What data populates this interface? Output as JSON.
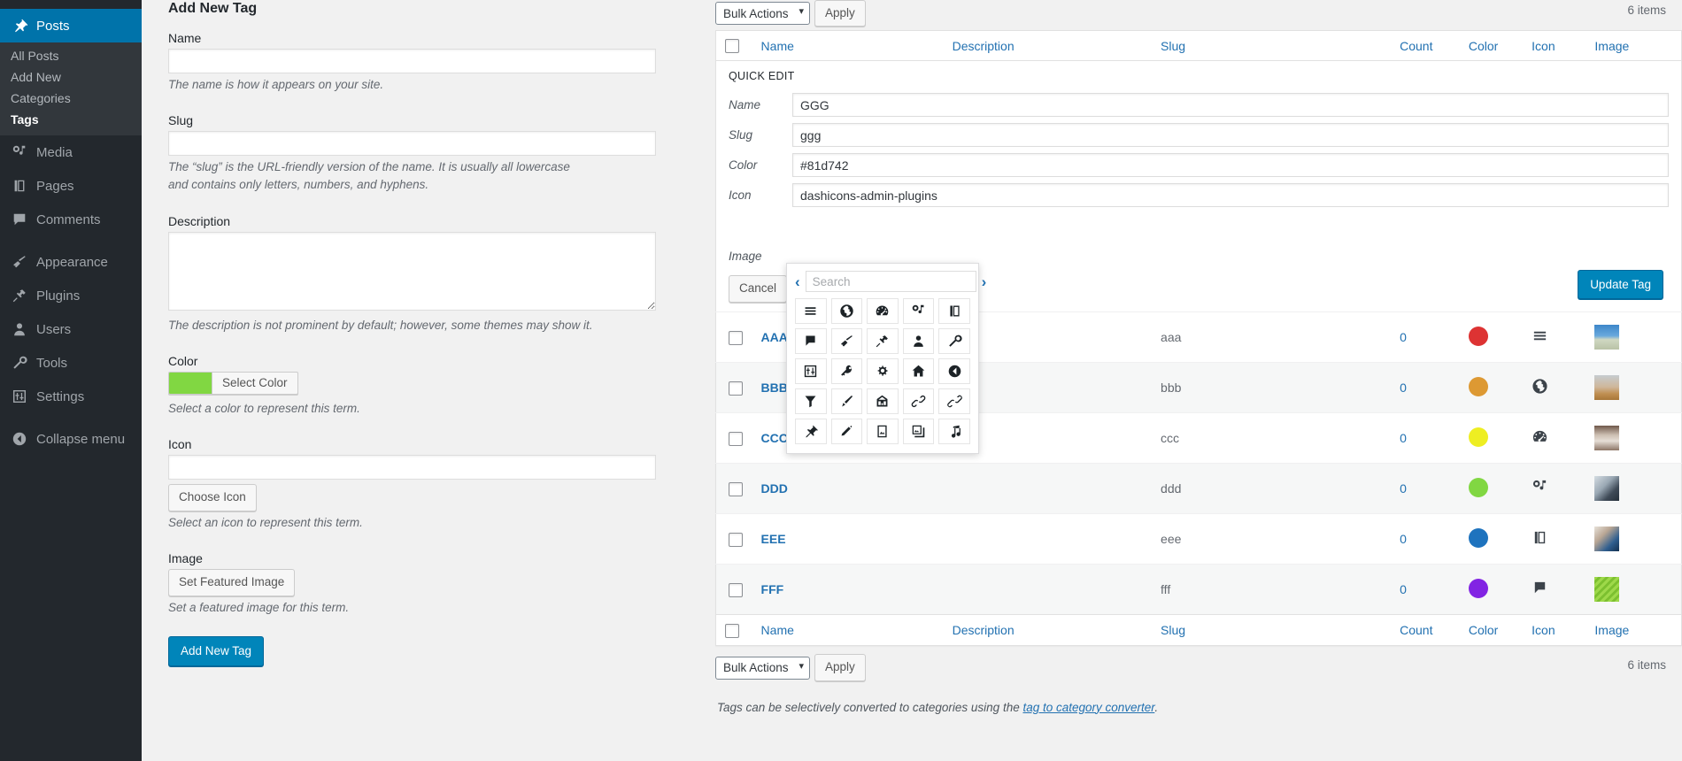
{
  "sidebar": {
    "items": [
      {
        "label": "Posts",
        "icon": "pin-icon",
        "name": "posts",
        "current": true,
        "submenu": [
          {
            "label": "All Posts",
            "name": "all-posts",
            "current": false
          },
          {
            "label": "Add New",
            "name": "add-new",
            "current": false
          },
          {
            "label": "Categories",
            "name": "categories",
            "current": false
          },
          {
            "label": "Tags",
            "name": "tags",
            "current": true
          }
        ]
      },
      {
        "label": "Media",
        "icon": "media-icon",
        "name": "media",
        "current": false
      },
      {
        "label": "Pages",
        "icon": "pages-icon",
        "name": "pages",
        "current": false
      },
      {
        "label": "Comments",
        "icon": "comments-icon",
        "name": "comments",
        "current": false
      },
      {
        "label": "Appearance",
        "icon": "appearance-icon",
        "name": "appearance",
        "current": false
      },
      {
        "label": "Plugins",
        "icon": "plugins-icon",
        "name": "plugins",
        "current": false
      },
      {
        "label": "Users",
        "icon": "users-icon",
        "name": "users",
        "current": false
      },
      {
        "label": "Tools",
        "icon": "tools-icon",
        "name": "tools",
        "current": false
      },
      {
        "label": "Settings",
        "icon": "settings-icon",
        "name": "settings",
        "current": false
      },
      {
        "label": "Collapse menu",
        "icon": "collapse-icon",
        "name": "collapse-menu",
        "current": false
      }
    ]
  },
  "add_form": {
    "heading": "Add New Tag",
    "name_label": "Name",
    "name_value": "",
    "name_hint": "The name is how it appears on your site.",
    "slug_label": "Slug",
    "slug_value": "",
    "slug_hint": "The “slug” is the URL-friendly version of the name. It is usually all lowercase and contains only letters, numbers, and hyphens.",
    "description_label": "Description",
    "description_value": "",
    "description_hint": "The description is not prominent by default; however, some themes may show it.",
    "color_label": "Color",
    "color_button": "Select Color",
    "color_value": "#81d742",
    "color_hint": "Select a color to represent this term.",
    "icon_label": "Icon",
    "icon_value": "",
    "icon_button": "Choose Icon",
    "icon_hint": "Select an icon to represent this term.",
    "image_label": "Image",
    "image_button": "Set Featured Image",
    "image_hint": "Set a featured image for this term.",
    "submit": "Add New Tag"
  },
  "tablenav": {
    "bulk_actions": "Bulk Actions",
    "apply": "Apply",
    "items_top": "6 items",
    "items_bottom": "6 items"
  },
  "table": {
    "columns": [
      "Name",
      "Description",
      "Slug",
      "Count",
      "Color",
      "Icon",
      "Image"
    ],
    "rows": [
      {
        "name": "AAA",
        "description": "",
        "slug": "aaa",
        "count": "0",
        "color": "#dd3333",
        "icon": "menu-icon",
        "image": "thumb-trees"
      },
      {
        "name": "BBB",
        "description": "",
        "slug": "bbb",
        "count": "0",
        "color": "#dd9933",
        "icon": "site-icon",
        "image": "thumb-desert"
      },
      {
        "name": "CCC",
        "description": "",
        "slug": "ccc",
        "count": "0",
        "color": "#eeee22",
        "icon": "dashboard-icon",
        "image": "thumb-desk"
      },
      {
        "name": "DDD",
        "description": "",
        "slug": "ddd",
        "count": "0",
        "color": "#81d742",
        "icon": "media-icon",
        "image": "thumb-office"
      },
      {
        "name": "EEE",
        "description": "",
        "slug": "eee",
        "count": "0",
        "color": "#1e73be",
        "icon": "pages-icon",
        "image": "thumb-handshake"
      },
      {
        "name": "FFF",
        "description": "",
        "slug": "fff",
        "count": "0",
        "color": "#8224e3",
        "icon": "comments-icon",
        "image": "thumb-grass"
      }
    ]
  },
  "quick_edit": {
    "title": "QUICK EDIT",
    "name_label": "Name",
    "name_value": "GGG",
    "slug_label": "Slug",
    "slug_value": "ggg",
    "color_label": "Color",
    "color_value": "#81d742",
    "icon_label": "Icon",
    "icon_value": "dashicons-admin-plugins",
    "image_label": "Image",
    "cancel": "Cancel",
    "update": "Update Tag"
  },
  "icon_picker": {
    "search_placeholder": "Search",
    "prev_label": "‹",
    "next_label": "›",
    "icons": [
      "menu-icon",
      "site-icon",
      "dashboard-icon",
      "media-icon",
      "pages-icon",
      "comments-icon",
      "appearance-icon",
      "plugins-icon",
      "users-icon",
      "tools-icon",
      "settings-icon",
      "network-icon",
      "generic-icon",
      "home-icon",
      "collapse-icon",
      "filter-icon",
      "customizer-icon",
      "multisite-icon",
      "links-icon",
      "link-icon",
      "post-icon",
      "page-icon",
      "image-icon",
      "images-icon",
      "audio-icon"
    ]
  },
  "footer": {
    "note_prefix": "Tags can be selectively converted to categories using the ",
    "note_link": "tag to category converter",
    "note_suffix": "."
  }
}
